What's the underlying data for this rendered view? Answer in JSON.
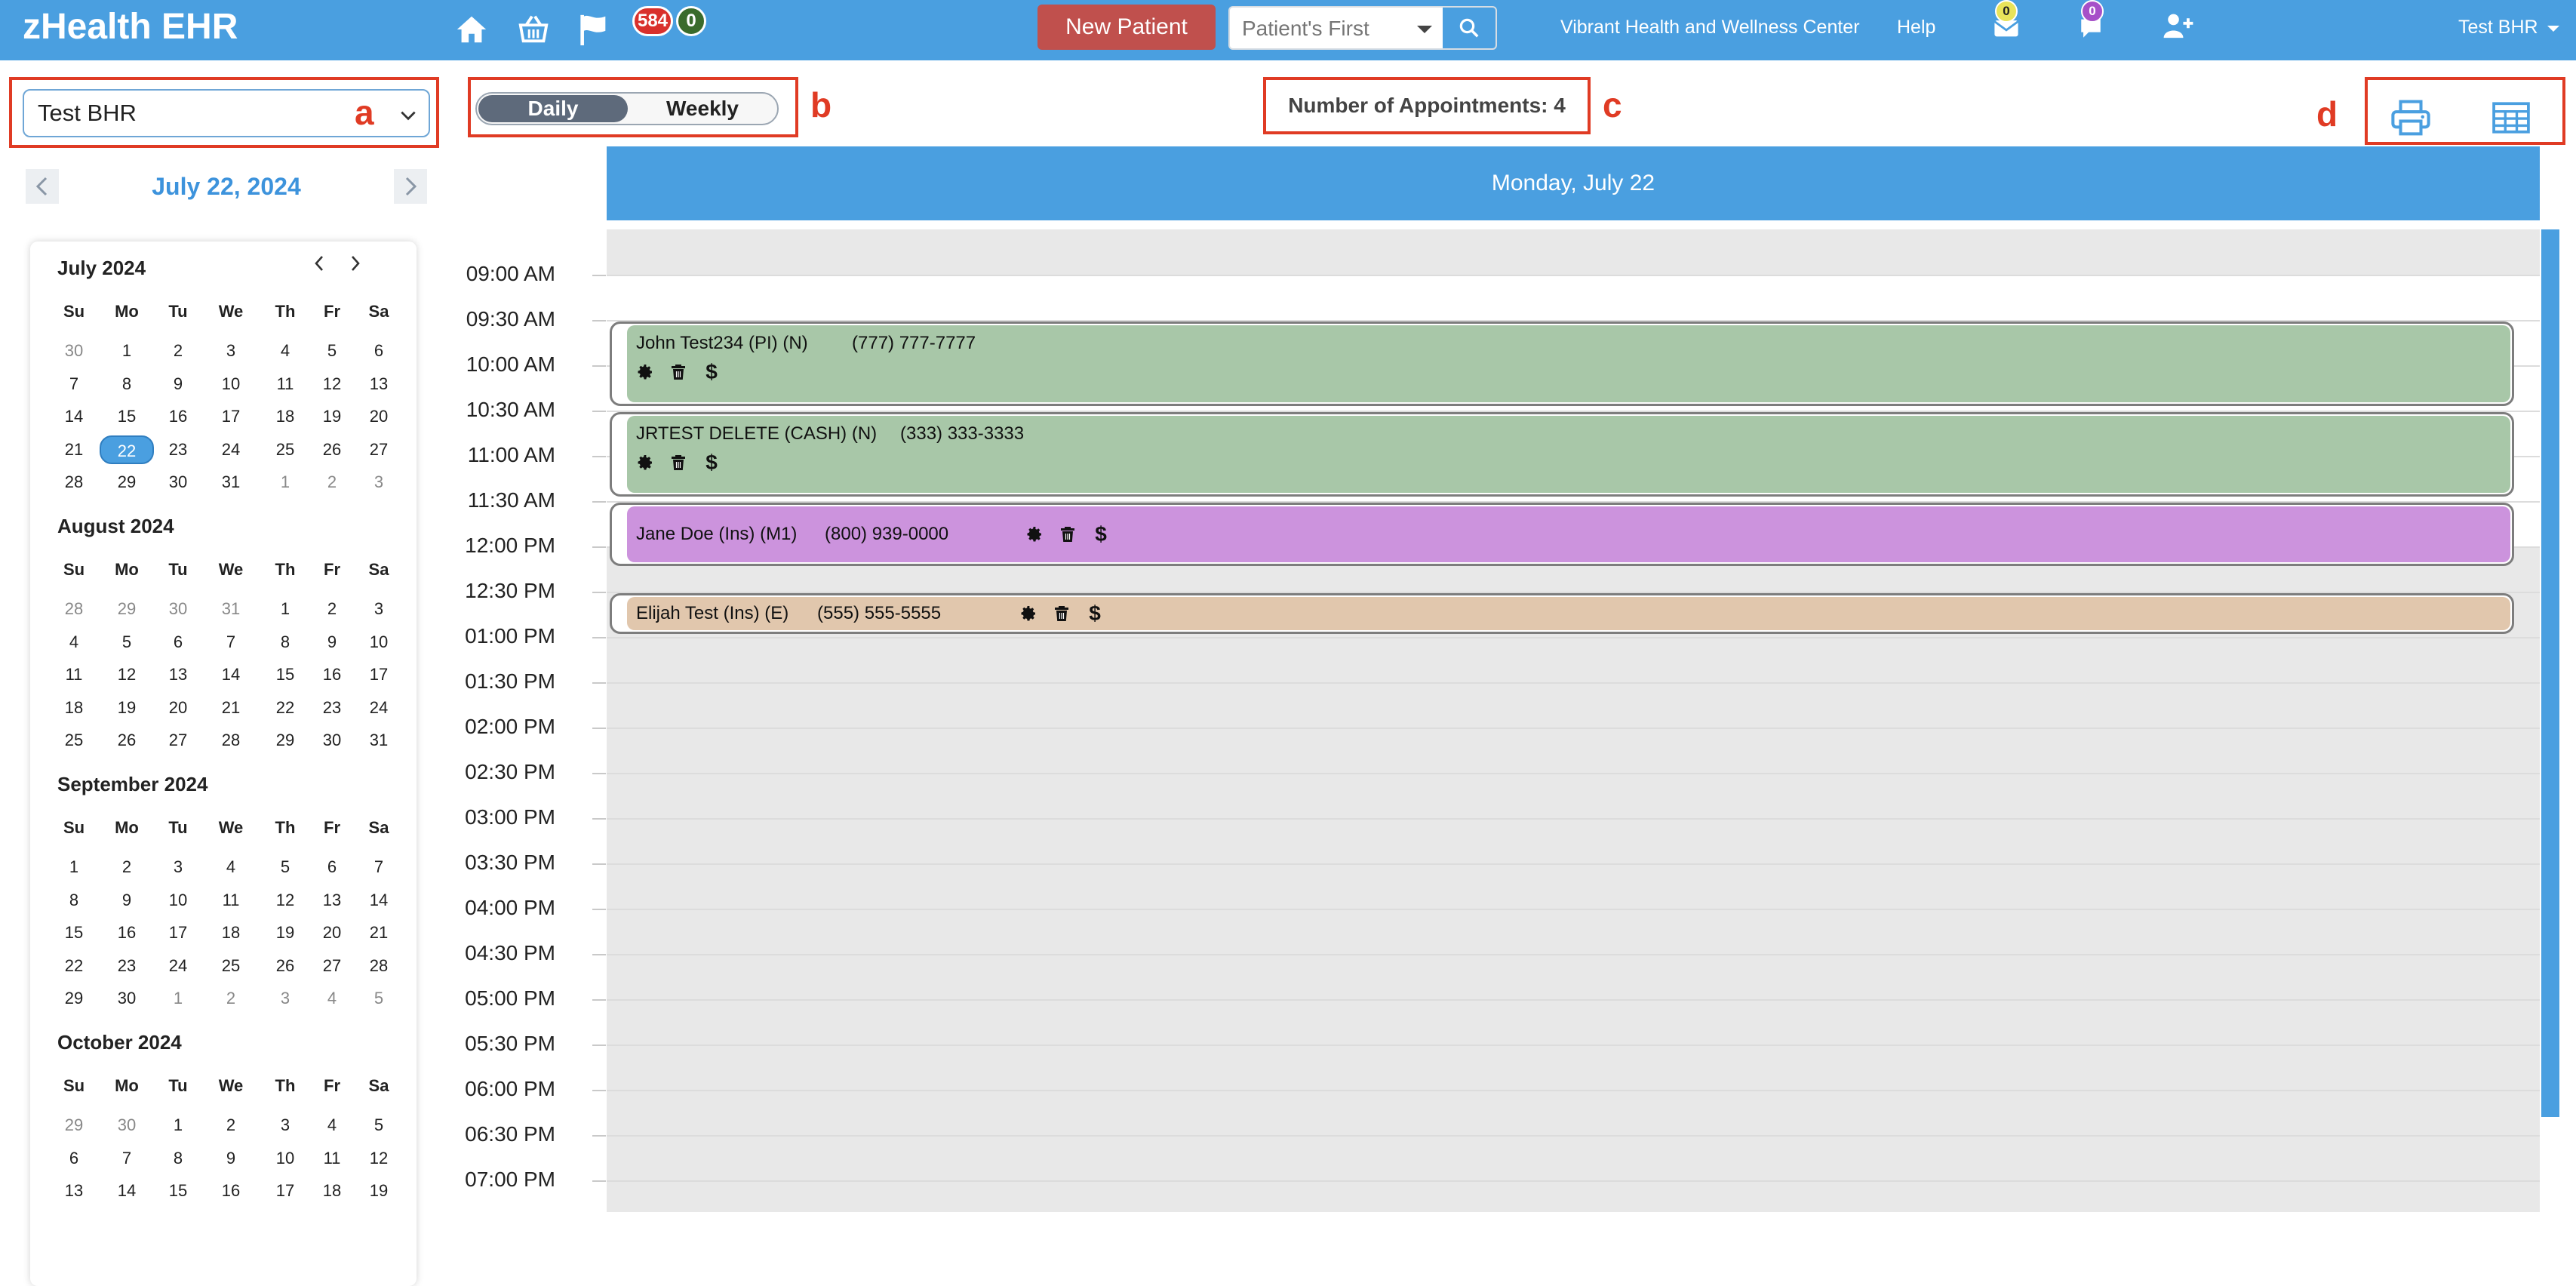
{
  "app": {
    "title": "zHealth EHR",
    "new_patient_label": "New Patient",
    "search_placeholder": "Patient's First",
    "clinic_name": "Vibrant Health and Wellness Center",
    "help_label": "Help",
    "user_label": "Test BHR",
    "flag_badge_count": "584",
    "flag_badge_count2": "0",
    "mail_badge_count": "0",
    "chat_badge_count": "0"
  },
  "annotations": {
    "a": "a",
    "b": "b",
    "c": "c",
    "d": "d"
  },
  "colors": {
    "brand": "#4a9fe0",
    "new_patient": "#c0504d",
    "appt_green": "#a8c7a8",
    "appt_purple": "#cc93dd",
    "appt_tan": "#e1c7ad",
    "annotation_red": "#e03b24"
  },
  "toolbar": {
    "provider_value": "Test BHR",
    "view_daily": "Daily",
    "view_weekly": "Weekly",
    "appointment_count": "Number of Appointments: 4"
  },
  "date_nav": {
    "current": "July 22, 2024"
  },
  "mini_calendar": {
    "weekdays": [
      "Su",
      "Mo",
      "Tu",
      "We",
      "Th",
      "Fr",
      "Sa"
    ],
    "months": [
      {
        "title": "July 2024",
        "weeks": [
          [
            "30",
            "1",
            "2",
            "3",
            "4",
            "5",
            "6"
          ],
          [
            "7",
            "8",
            "9",
            "10",
            "11",
            "12",
            "13"
          ],
          [
            "14",
            "15",
            "16",
            "17",
            "18",
            "19",
            "20"
          ],
          [
            "21",
            "22",
            "23",
            "24",
            "25",
            "26",
            "27"
          ],
          [
            "28",
            "29",
            "30",
            "31",
            "1",
            "2",
            "3"
          ]
        ]
      },
      {
        "title": "August 2024",
        "weeks": [
          [
            "28",
            "29",
            "30",
            "31",
            "1",
            "2",
            "3"
          ],
          [
            "4",
            "5",
            "6",
            "7",
            "8",
            "9",
            "10"
          ],
          [
            "11",
            "12",
            "13",
            "14",
            "15",
            "16",
            "17"
          ],
          [
            "18",
            "19",
            "20",
            "21",
            "22",
            "23",
            "24"
          ],
          [
            "25",
            "26",
            "27",
            "28",
            "29",
            "30",
            "31"
          ]
        ]
      },
      {
        "title": "September 2024",
        "weeks": [
          [
            "1",
            "2",
            "3",
            "4",
            "5",
            "6",
            "7"
          ],
          [
            "8",
            "9",
            "10",
            "11",
            "12",
            "13",
            "14"
          ],
          [
            "15",
            "16",
            "17",
            "18",
            "19",
            "20",
            "21"
          ],
          [
            "22",
            "23",
            "24",
            "25",
            "26",
            "27",
            "28"
          ],
          [
            "29",
            "30",
            "1",
            "2",
            "3",
            "4",
            "5"
          ]
        ]
      },
      {
        "title": "October 2024",
        "weeks": [
          [
            "29",
            "30",
            "1",
            "2",
            "3",
            "4",
            "5"
          ],
          [
            "6",
            "7",
            "8",
            "9",
            "10",
            "11",
            "12"
          ],
          [
            "13",
            "14",
            "15",
            "16",
            "17",
            "18",
            "19"
          ]
        ]
      }
    ],
    "selected": "22"
  },
  "schedule": {
    "day_header": "Monday, July 22",
    "times": [
      "09:00 AM",
      "09:30 AM",
      "10:00 AM",
      "10:30 AM",
      "11:00 AM",
      "11:30 AM",
      "12:00 PM",
      "12:30 PM",
      "01:00 PM",
      "01:30 PM",
      "02:00 PM",
      "02:30 PM",
      "03:00 PM",
      "03:30 PM",
      "04:00 PM",
      "04:30 PM",
      "05:00 PM",
      "05:30 PM",
      "06:00 PM",
      "06:30 PM",
      "07:00 PM"
    ],
    "appointments": [
      {
        "name": "John Test234 (PI) (N)",
        "phone": "(777) 777-7777",
        "dollar": "$"
      },
      {
        "name": "JRTEST DELETE (CASH) (N)",
        "phone": "(333) 333-3333",
        "dollar": "$"
      },
      {
        "name": "Jane Doe (Ins) (M1)",
        "phone": "(800) 939-0000",
        "dollar": "$"
      },
      {
        "name": "Elijah Test (Ins) (E)",
        "phone": "(555) 555-5555",
        "dollar": "$"
      }
    ]
  }
}
